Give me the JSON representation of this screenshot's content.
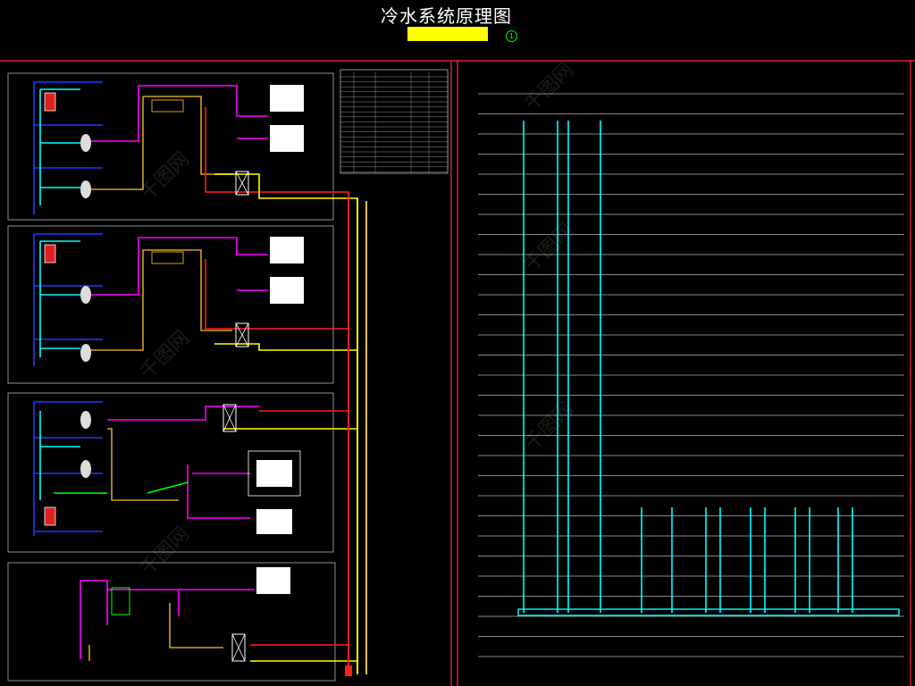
{
  "header": {
    "title": "冷水系统原理图",
    "legend_number": "1"
  },
  "colors": {
    "supply": "#ff00ff",
    "return": "#ffd24d",
    "pipe_cyan": "#00ffff",
    "pipe_blue": "#1e3cff",
    "pipe_red": "#ff2020",
    "pipe_yellow": "#ffff00",
    "pipe_green": "#00ff00",
    "frame_red": "#ff2a4a",
    "frame_gray": "#b4b4b4"
  },
  "watermark": "千图网"
}
